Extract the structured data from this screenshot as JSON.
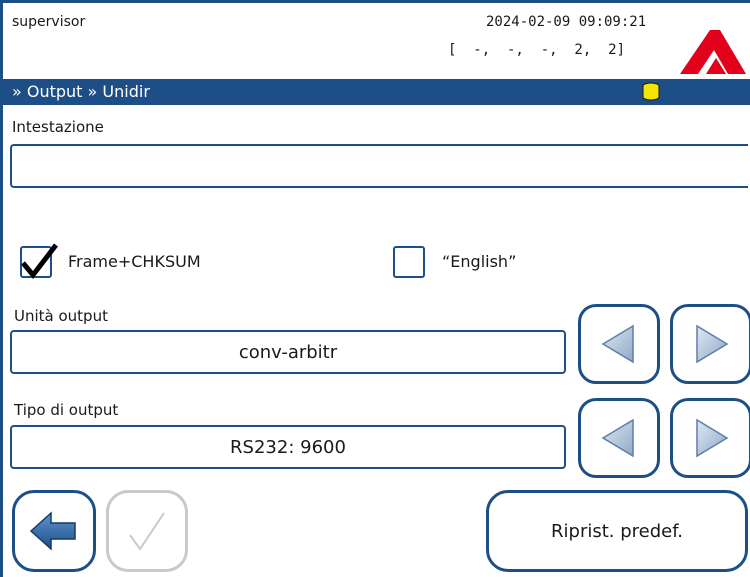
{
  "status_bar": {
    "user": "supervisor",
    "datetime": "2024-02-09 09:09:21",
    "indicators": "[  -,  -,  -,  2,  2]",
    "logo_icon": "company-logo-red-triangle"
  },
  "title_bar": {
    "breadcrumb": "» Output » Unidir",
    "status_icon": "database-icon",
    "background": "#1d4f86",
    "status_icon_color": "#f2e600"
  },
  "form": {
    "header": {
      "label": "Intestazione",
      "value": "",
      "placeholder": ""
    },
    "checkboxes": [
      {
        "label": "Frame+CHKSUM",
        "checked": true
      },
      {
        "label": "“English”",
        "checked": false
      }
    ],
    "output_unit": {
      "label": "Unità output",
      "value": "conv-arbitr"
    },
    "output_type": {
      "label": "Tipo di output",
      "value": "RS232: 9600"
    }
  },
  "footer": {
    "back_icon": "back-arrow-icon",
    "confirm_icon": "checkmark-icon",
    "confirm_enabled": false,
    "reset_label": "Riprist. predef."
  },
  "colors": {
    "accent": "#1d4f86",
    "logo_red": "#e2001a",
    "disabled": "#c9c9c9"
  }
}
